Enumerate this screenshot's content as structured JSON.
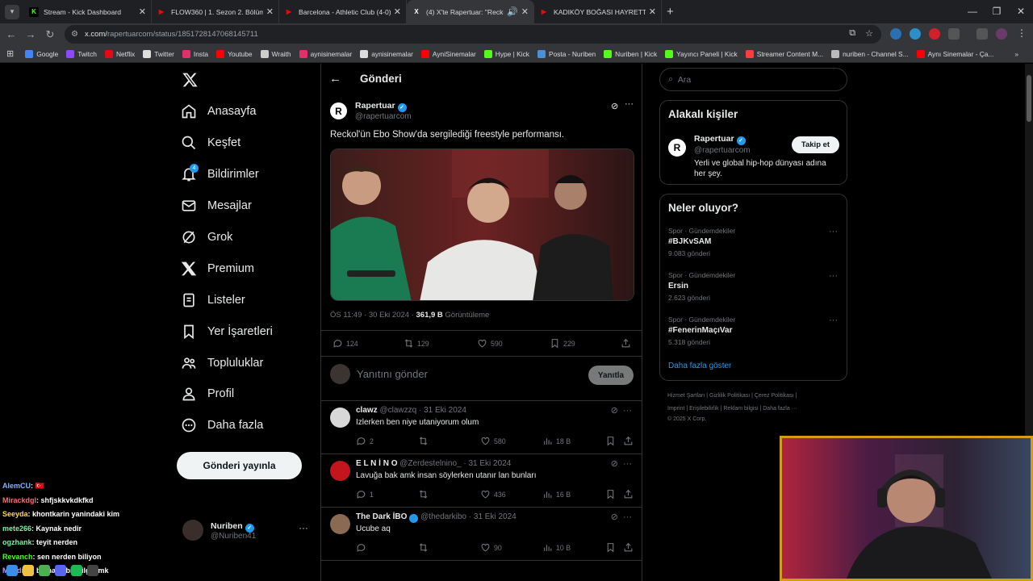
{
  "tabs": [
    {
      "title": "Stream - Kick Dashboard",
      "fav": "K",
      "color": "#53fc18"
    },
    {
      "title": "FLOW360 | 1. Sezon 2. Bölüm -",
      "fav": "▶",
      "color": "#ff0000"
    },
    {
      "title": "Barcelona - Athletic Club (4-0)",
      "fav": "▶",
      "color": "#ff0000"
    },
    {
      "title": "(4) X'te Rapertuar: \"Reckol'",
      "fav": "X",
      "color": "#000000",
      "active": true
    },
    {
      "title": "KADIKÖY BOĞASI HAYRETTİN İ",
      "fav": "▶",
      "color": "#ff0000"
    }
  ],
  "url": {
    "host": "x.com/",
    "path": "rapertuarcom/status/1851728147068145711"
  },
  "bookmarks": [
    "Google",
    "Twitch",
    "Netflix",
    "Twitter",
    "Insta",
    "Youtube",
    "Wraith",
    "aynisinemalar",
    "aynisinemalar",
    "AyniSinemalar",
    "Hype | Kick",
    "Posta - Nuriben",
    "Nuriben | Kick",
    "Yayıncı Paneli | Kick",
    "Streamer Content M...",
    "nuriben - Channel S...",
    "Aynı Sinemalar - Ça..."
  ],
  "nav": {
    "home": "Anasayfa",
    "explore": "Keşfet",
    "notifications": "Bildirimler",
    "notif_count": "4",
    "messages": "Mesajlar",
    "grok": "Grok",
    "premium": "Premium",
    "lists": "Listeler",
    "bookmarks": "Yer İşaretleri",
    "communities": "Topluluklar",
    "profile": "Profil",
    "more": "Daha fazla",
    "post_button": "Gönderi yayınla"
  },
  "me": {
    "name": "Nuriben",
    "handle": "@Nuriben41"
  },
  "header": {
    "title": "Gönderi"
  },
  "post": {
    "name": "Rapertuar",
    "handle": "@rapertuarcom",
    "avatar_letter": "R",
    "text": "Reckol'ün Ebo Show'da sergilediği freestyle performansı.",
    "time": "ÖS 11:49 · 30 Eki 2024 · ",
    "views": "361,9 B",
    "views_label": " Görüntüleme",
    "replies": "124",
    "reposts": "129",
    "likes": "590",
    "saves": "229"
  },
  "reply_box": {
    "placeholder": "Yanıtını gönder",
    "button": "Yanıtla"
  },
  "replies": [
    {
      "name": "clawz",
      "handle": "@clawzzq · 31 Eki 2024",
      "text": "Izlerken ben niye utaniyorum olum",
      "replies": "2",
      "reposts": "",
      "likes": "580",
      "views": "18 B",
      "avatar": "#d8d8d8"
    },
    {
      "name": "E L N İ N O",
      "handle": "@Zerdestelnino_ · 31 Eki 2024",
      "text": "Lavuğa bak amk insan söylerken utanır lan bunları",
      "replies": "1",
      "reposts": "",
      "likes": "436",
      "views": "16 B",
      "avatar": "#c4151c"
    },
    {
      "name": "The Dark İBO",
      "handle": "@thedarkibo · 31 Eki 2024",
      "text": "Ucube aq",
      "replies": "",
      "reposts": "",
      "likes": "90",
      "views": "10 B",
      "avatar": "#8a6a50"
    }
  ],
  "search": {
    "placeholder": "Ara"
  },
  "related": {
    "title": "Alakalı kişiler",
    "name": "Rapertuar",
    "handle": "@rapertuarcom",
    "bio": "Yerli ve global hip-hop dünyası adına her şey.",
    "follow": "Takip et"
  },
  "trends": {
    "title": "Neler oluyor?",
    "items": [
      {
        "cat": "Spor · Gündemdekiler",
        "tag": "#BJKvSAM",
        "count": "9.083 gönderi"
      },
      {
        "cat": "Spor · Gündemdekiler",
        "tag": "Ersin",
        "count": "2.623 gönderi"
      },
      {
        "cat": "Spor · Gündemdekiler",
        "tag": "#FenerinMaçıVar",
        "count": "5.318 gönderi"
      }
    ],
    "more": "Daha fazla göster"
  },
  "footer": {
    "l1": "Hizmet Şartları   |   Gizlilik Politikası   |   Çerez Politikası   |",
    "l2": "Imprint   |   Erişilebilirlik   |   Reklam bilgisi   |   Daha fazla ···",
    "l3": "© 2025 X Corp."
  },
  "chat": [
    {
      "user": "AlemCU",
      "msg": ": 🇹🇷",
      "color": "#8ab4f8"
    },
    {
      "user": "Mirackdgl",
      "msg": ": shfjskkvkdkfkd",
      "color": "#ff6b6b"
    },
    {
      "user": "Seeyda",
      "msg": ": khontkarin yanindaki kim",
      "color": "#ffd84a"
    },
    {
      "user": "mete266",
      "msg": ": Kaynak nedir",
      "color": "#7ef0a0"
    },
    {
      "user": "ogzhank",
      "msg": ": teyit nerden",
      "color": "#7ef0a0"
    },
    {
      "user": "Revanch",
      "msg": ": sen nerden biliyon",
      "color": "#53fc18"
    },
    {
      "user": "Muadib0",
      "msg": ": bu nasıl bir bilgi amk",
      "color": "#b9f"
    }
  ]
}
